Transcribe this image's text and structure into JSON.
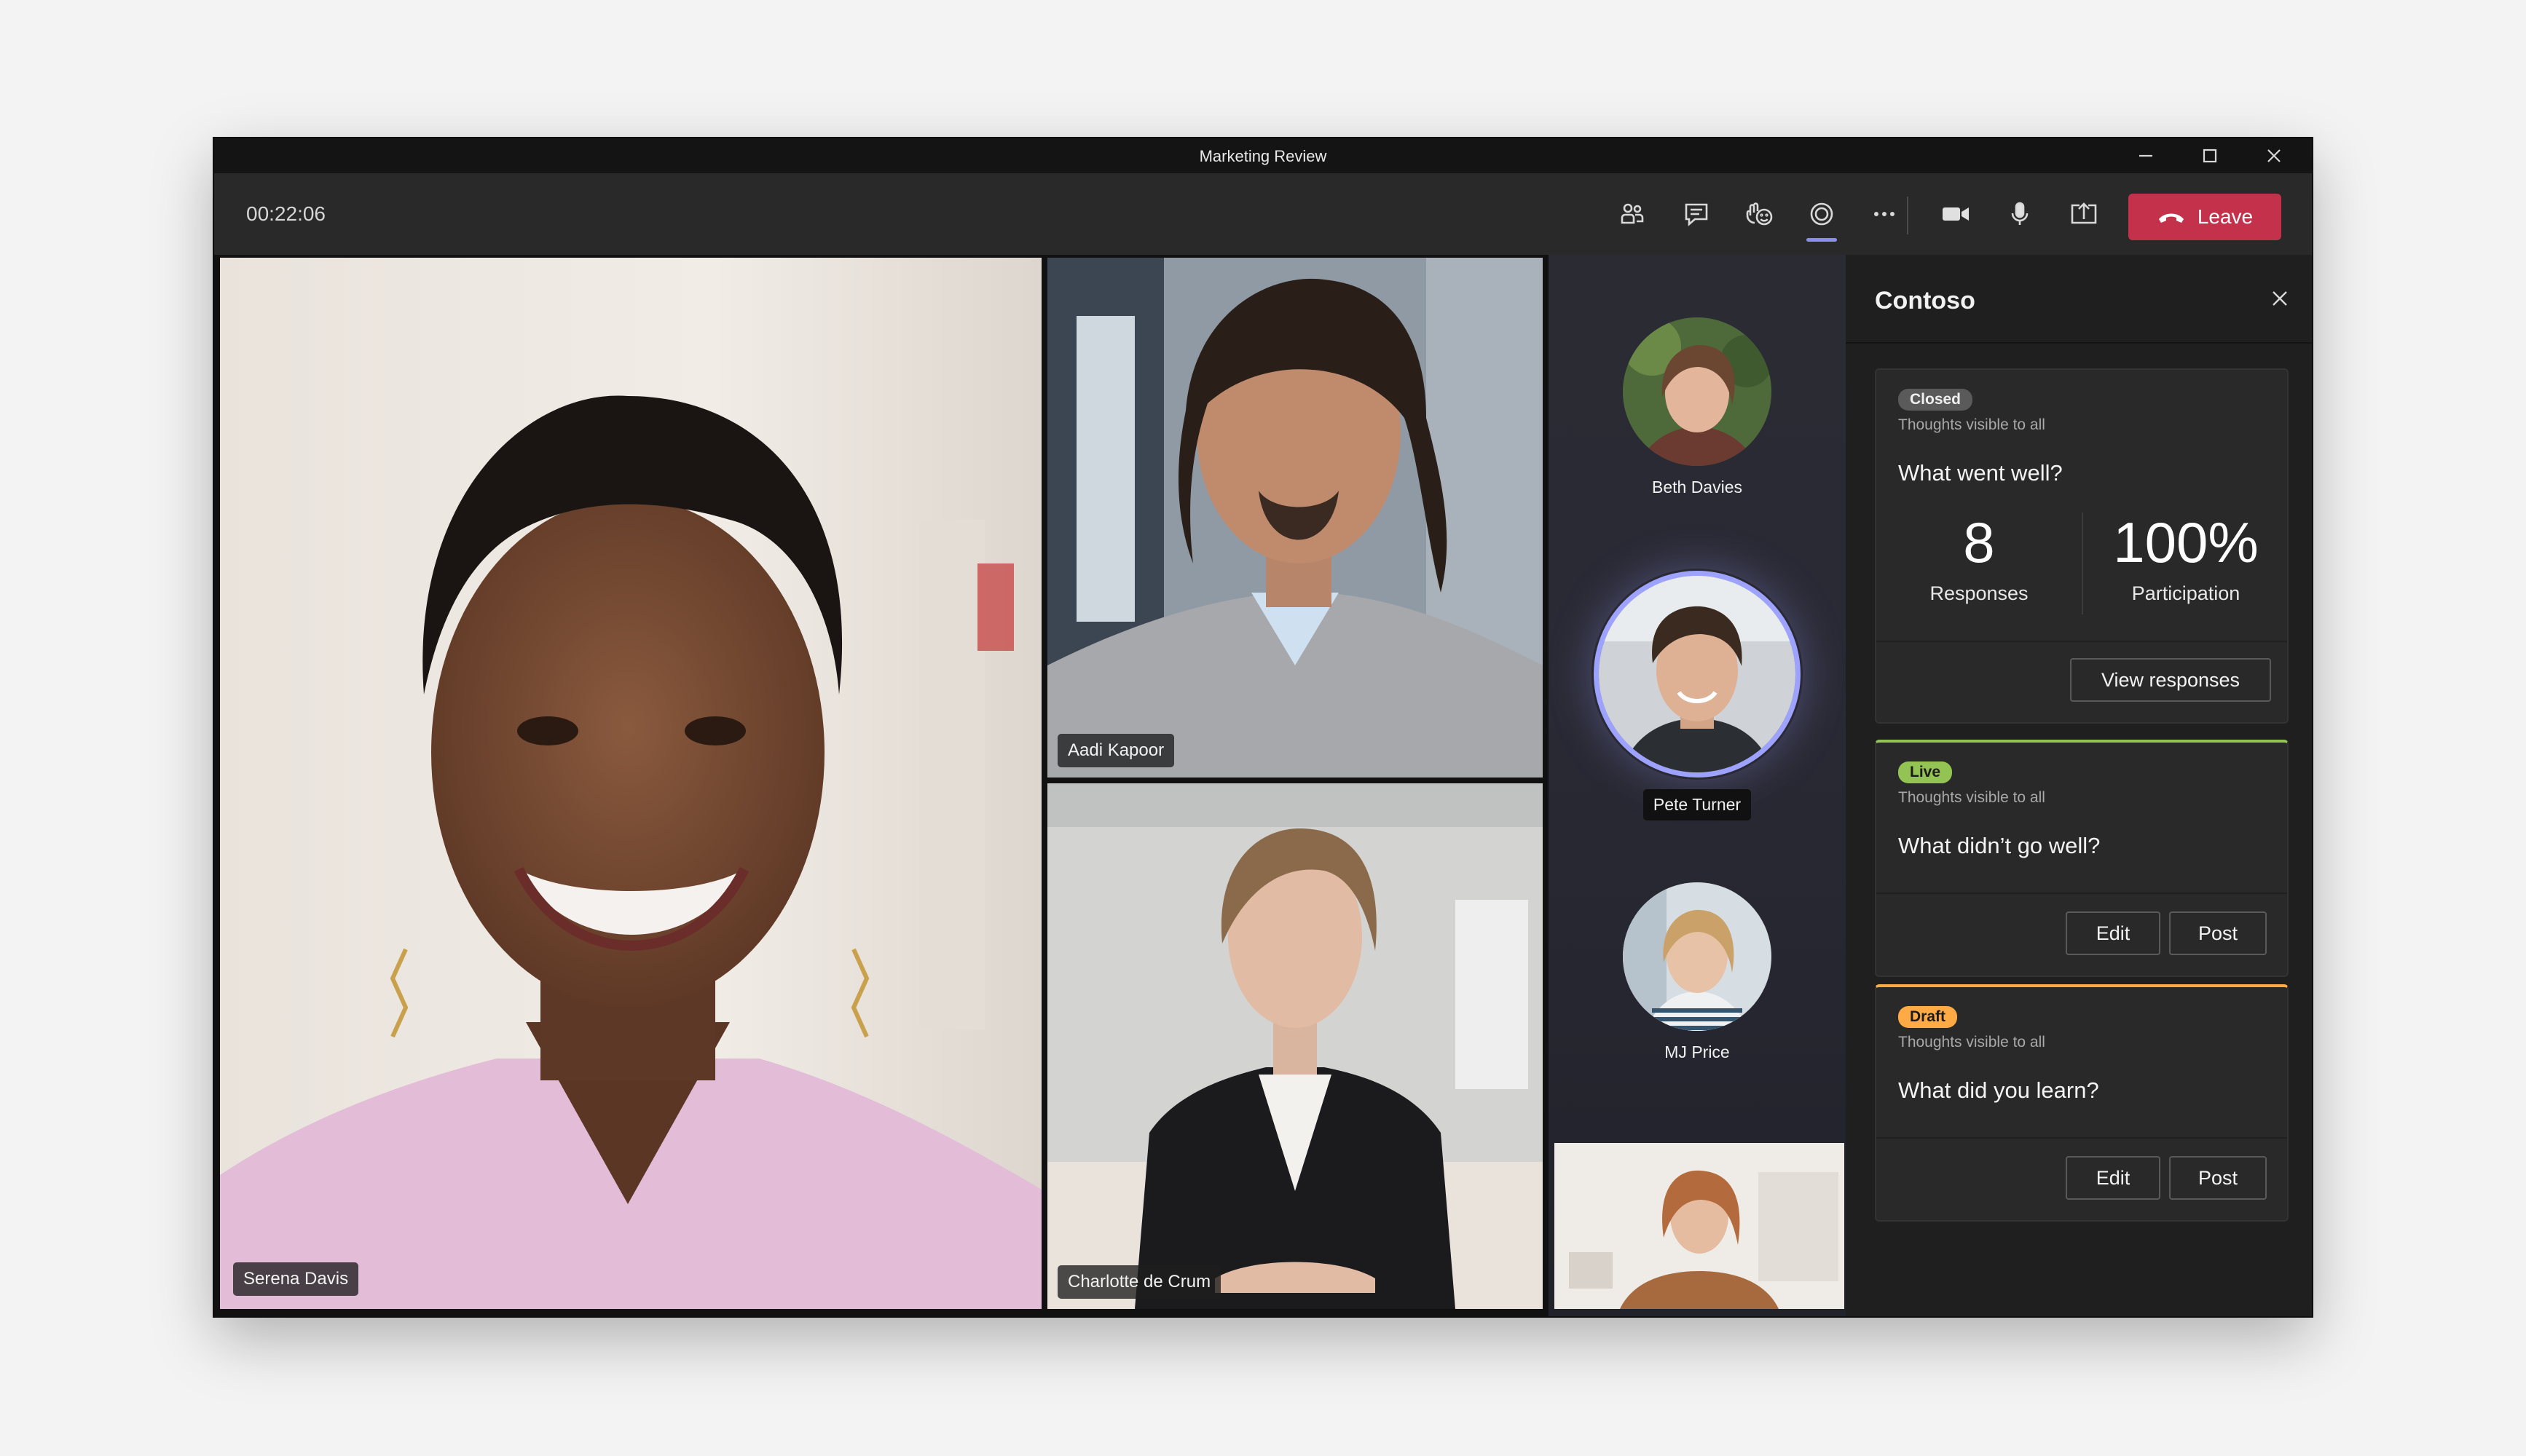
{
  "window": {
    "title": "Marketing Review"
  },
  "callbar": {
    "timer": "00:22:06",
    "leave_label": "Leave",
    "leave_color": "#c4314b",
    "accent_color": "#8b8cf0",
    "buttons": [
      "people-icon",
      "chat-icon",
      "reactions-icon",
      "app-icon",
      "more-icon",
      "camera-icon",
      "mic-icon",
      "share-icon"
    ]
  },
  "participants": {
    "main": "Serena Davis",
    "top_right": "Aadi Kapoor",
    "bottom_right": "Charlotte de Crum",
    "roster": [
      "Beth Davies",
      "Pete Turner",
      "MJ Price"
    ]
  },
  "panel": {
    "title": "Contoso",
    "cards": [
      {
        "status": "Closed",
        "visibility": "Thoughts visible to all",
        "question": "What went well?",
        "stat1_value": "8",
        "stat1_label": "Responses",
        "stat2_value": "100%",
        "stat2_label": "Participation",
        "action": "View responses"
      },
      {
        "status": "Live",
        "visibility": "Thoughts visible to all",
        "question": "What didn’t go well?",
        "edit": "Edit",
        "post": "Post"
      },
      {
        "status": "Draft",
        "visibility": "Thoughts visible to all",
        "question": "What did you learn?",
        "edit": "Edit",
        "post": "Post"
      }
    ]
  }
}
